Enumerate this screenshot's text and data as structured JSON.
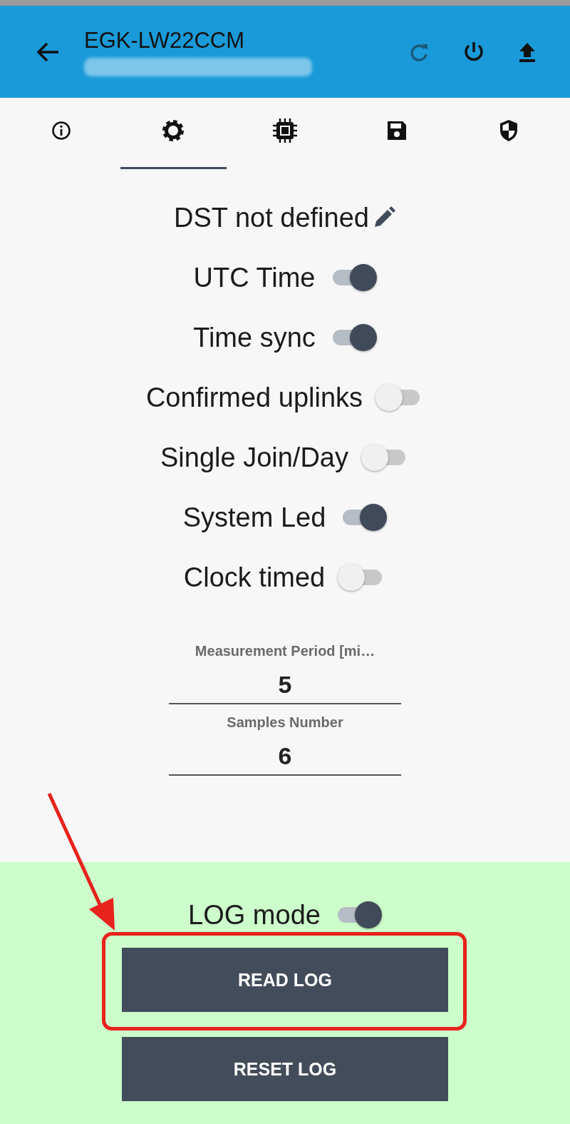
{
  "header": {
    "title": "EGK-LW22CCM"
  },
  "tabs": [
    {
      "kind": "info",
      "selected": false
    },
    {
      "kind": "gear",
      "selected": true
    },
    {
      "kind": "chip",
      "selected": false
    },
    {
      "kind": "save",
      "selected": false
    },
    {
      "kind": "shield",
      "selected": false
    }
  ],
  "settings": [
    {
      "kind": "edit",
      "label": "DST not defined"
    },
    {
      "kind": "toggle",
      "label": "UTC Time",
      "on": true
    },
    {
      "kind": "toggle",
      "label": "Time sync",
      "on": true
    },
    {
      "kind": "toggle",
      "label": "Confirmed uplinks",
      "on": false
    },
    {
      "kind": "toggle",
      "label": "Single Join/Day",
      "on": false
    },
    {
      "kind": "toggle",
      "label": "System Led",
      "on": true
    },
    {
      "kind": "toggle",
      "label": "Clock timed",
      "on": false
    }
  ],
  "fields": [
    {
      "label": "Measurement Period [mi…",
      "value": "5"
    },
    {
      "label": "Samples Number",
      "value": "6"
    }
  ],
  "log": {
    "label": "LOG mode",
    "on": true,
    "buttons": [
      {
        "label": "READ LOG",
        "highlighted": true
      },
      {
        "label": "RESET LOG",
        "highlighted": false
      }
    ]
  }
}
